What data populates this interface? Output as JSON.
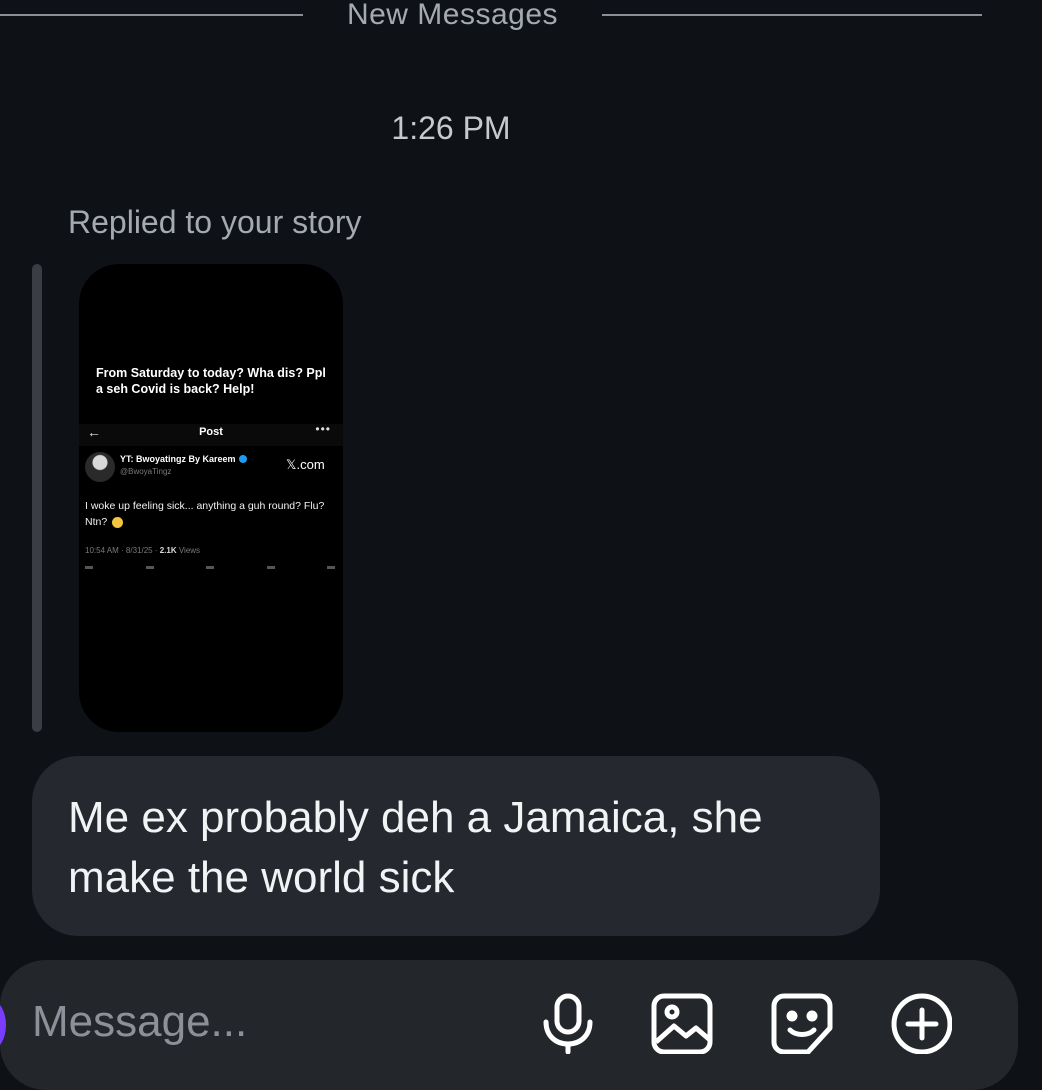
{
  "divider": {
    "label": "New Messages"
  },
  "timestamp": "1:26 PM",
  "reply": {
    "label": "Replied to your story",
    "story": {
      "caption": "From Saturday to today? Wha dis? Ppl a seh Covid is back? Help!",
      "post_header": {
        "back_icon": "arrow-left-icon",
        "title": "Post",
        "more_icon": "more-icon"
      },
      "author_name": "YT: Bwoyatingz By Kareem",
      "author_handle": "@BwoyaTingz",
      "source_label": "𝕏.com",
      "tweet_text": "I woke up feeling sick... anything a guh round? Flu? Ntn?",
      "meta_prefix": "10:54 AM · 8/31/25 · ",
      "meta_views_count": "2.1K",
      "meta_views_label": " Views"
    }
  },
  "message": {
    "text": "Me ex probably deh a Jamaica, she make the world sick"
  },
  "composer": {
    "placeholder": "Message...",
    "icons": [
      "microphone-icon",
      "image-icon",
      "sticker-icon",
      "plus-circle-icon"
    ]
  },
  "colors": {
    "background": "#0e1116",
    "bubble": "#25282e",
    "composer": "#23262b"
  }
}
